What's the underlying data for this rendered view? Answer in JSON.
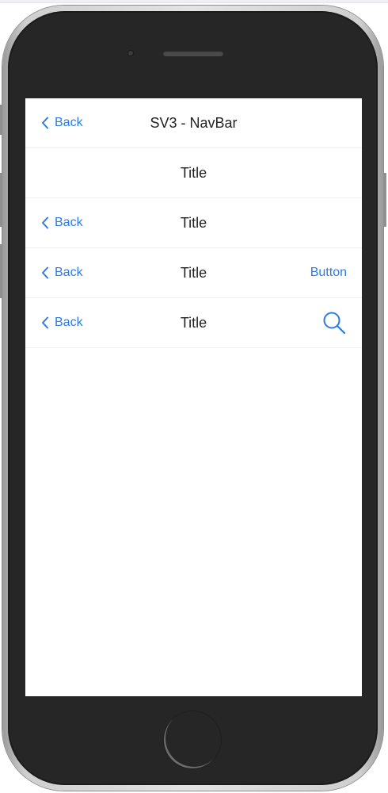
{
  "colors": {
    "accent": "#2d7be5",
    "title_text": "#222222",
    "device_body": "#262626",
    "device_frame": "#cfcfcf",
    "screen_bg": "#ffffff"
  },
  "navbars": [
    {
      "back_label": "Back",
      "title": "SV3 - NavBar"
    },
    {
      "title": "Title"
    },
    {
      "back_label": "Back",
      "title": "Title"
    },
    {
      "back_label": "Back",
      "title": "Title",
      "right_button_label": "Button"
    },
    {
      "back_label": "Back",
      "title": "Title",
      "right_icon": "search-icon"
    }
  ]
}
